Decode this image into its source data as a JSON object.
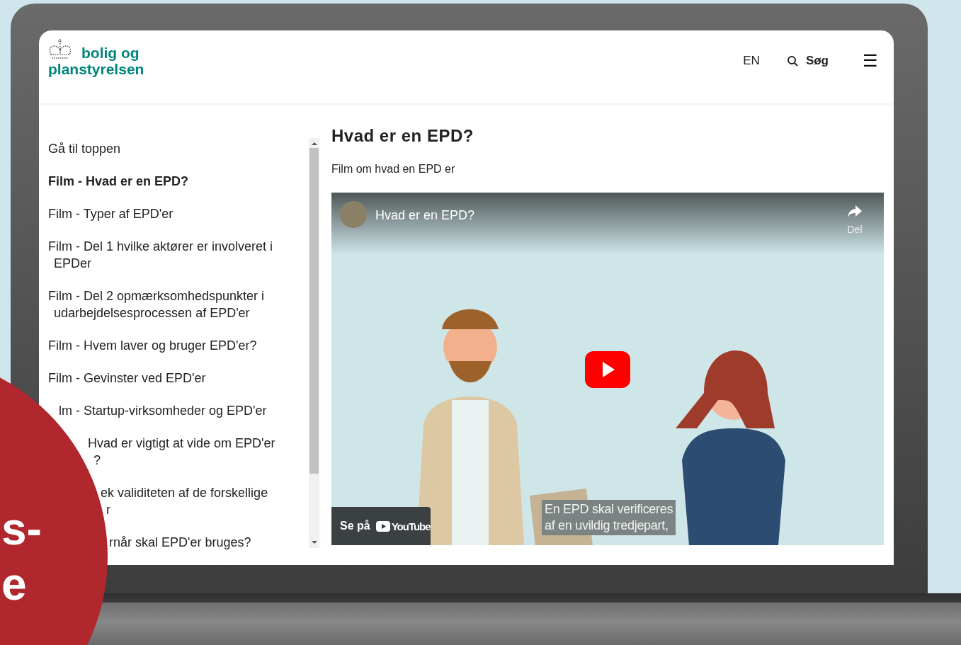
{
  "header": {
    "logo_line1": "bolig og",
    "logo_line2": "planstyrelsen",
    "language": "EN",
    "search": "Søg",
    "menu": "☰"
  },
  "sidebar": {
    "items": [
      {
        "lines": [
          "Gå til toppen"
        ],
        "selected": false
      },
      {
        "lines": [
          "Film - Hvad er en EPD?"
        ],
        "selected": true
      },
      {
        "lines": [
          "Film - Typer af EPD'er"
        ],
        "selected": false
      },
      {
        "lines": [
          "Film - Del 1 hvilke aktører er involveret i",
          "EPDer"
        ],
        "selected": false
      },
      {
        "lines": [
          "Film - Del 2 opmærksomhedspunkter i",
          "udarbejdelsesprocessen af EPD'er"
        ],
        "selected": false
      },
      {
        "lines": [
          "Film - Hvem laver og bruger EPD'er?"
        ],
        "selected": false
      },
      {
        "lines": [
          "Film - Gevinster ved EPD'er"
        ],
        "selected": false
      },
      {
        "lines": [
          "lm - Startup-virksomheder og EPD'er"
        ],
        "selected": false
      },
      {
        "lines": [
          "Hvad er vigtigt at vide om EPD'er",
          "?"
        ],
        "selected": false
      },
      {
        "lines": [
          "ek validiteten af de forskellige",
          "r"
        ],
        "selected": false
      },
      {
        "lines": [
          "rnår skal EPD'er bruges?"
        ],
        "selected": false
      }
    ]
  },
  "main": {
    "heading": "Hvad er en EPD?",
    "subtitle": "Film om hvad en EPD er",
    "video": {
      "title": "Hvad er en EPD?",
      "share": "Del",
      "watch_on": "Se på",
      "platform": "YouTube",
      "caption": [
        "En EPD skal verificeres",
        "af en uvildig tredjepart,"
      ]
    }
  },
  "overlay": {
    "lines": [
      "s-",
      "e"
    ]
  }
}
